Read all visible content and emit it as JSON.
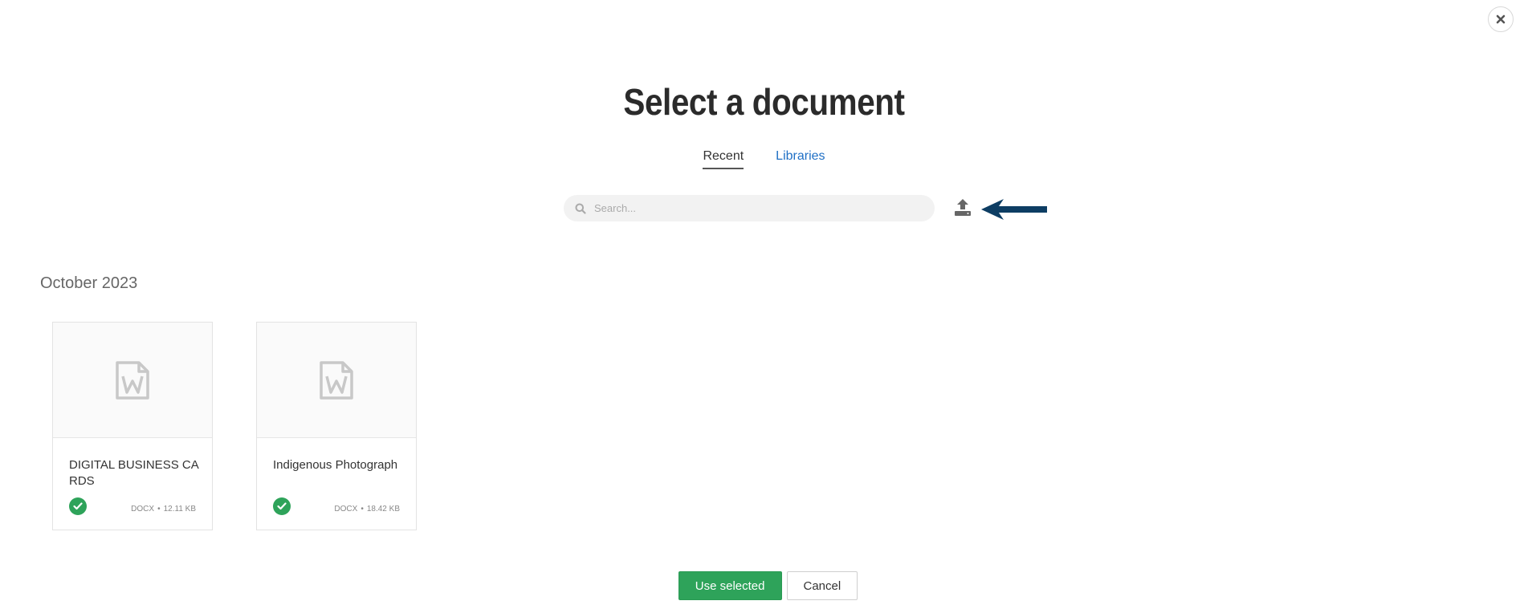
{
  "dialog": {
    "title": "Select a document",
    "close_icon": "close-icon"
  },
  "tabs": [
    {
      "label": "Recent",
      "active": true
    },
    {
      "label": "Libraries",
      "active": false
    }
  ],
  "search": {
    "value": "",
    "placeholder": "Search...",
    "icon": "search-icon"
  },
  "upload": {
    "icon": "upload-icon",
    "annotation": "arrow-left-annotation",
    "arrow_color": "#0d3d63"
  },
  "section": {
    "heading": "October 2023"
  },
  "documents": [
    {
      "name": "DIGITAL BUSINESS CARDS",
      "type": "DOCX",
      "size": "12.11 KB",
      "selected": true,
      "icon": "word-document-icon"
    },
    {
      "name": "Indigenous Photograph",
      "type": "DOCX",
      "size": "18.42 KB",
      "selected": true,
      "icon": "word-document-icon"
    }
  ],
  "footer": {
    "use_selected_label": "Use selected",
    "cancel_label": "Cancel"
  },
  "colors": {
    "accent_green": "#2ea35a",
    "link_blue": "#1f6fc5"
  }
}
